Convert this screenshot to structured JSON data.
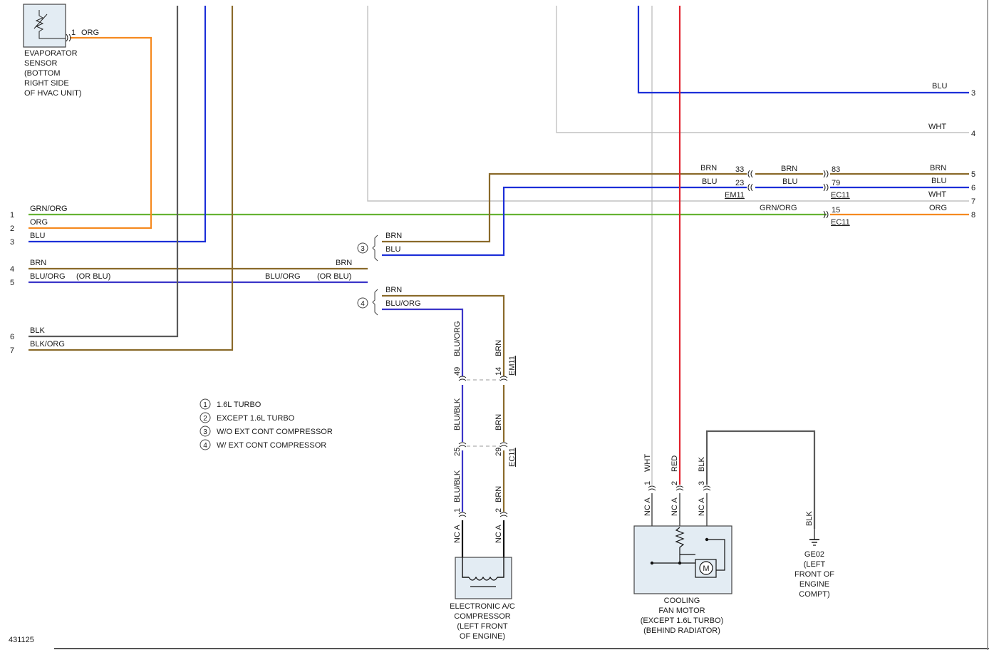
{
  "colors": {
    "brn": "#8a6a2a",
    "blu": "#1c2fd8",
    "blu_org": "#3b35c8",
    "grn_org": "#66b233",
    "org": "#f58a20",
    "red": "#e1202b",
    "blk": "#555555",
    "gray": "#bdbdbd",
    "component_fill": "#e3ecf3"
  },
  "left_pins": [
    {
      "num": "1",
      "color": "GRN/ORG"
    },
    {
      "num": "2",
      "color": "ORG"
    },
    {
      "num": "3",
      "color": "BLU"
    },
    {
      "num": "4",
      "color": "BRN"
    },
    {
      "num": "5",
      "color": "BLU/ORG",
      "alt": "(OR BLU)"
    },
    {
      "num": "6",
      "color": "BLK"
    },
    {
      "num": "7",
      "color": "BLK/ORG"
    }
  ],
  "mid_labels": {
    "brn_4": "BRN",
    "bluorg_5": "BLU/ORG",
    "bluorg_5_alt": "(OR BLU)"
  },
  "right_pins": [
    {
      "num": "3",
      "color": "BLU"
    },
    {
      "num": "4",
      "color": "WHT"
    },
    {
      "num": "5",
      "color": "BRN"
    },
    {
      "num": "6",
      "color": "BLU"
    },
    {
      "num": "7",
      "color": "WHT"
    },
    {
      "num": "8",
      "color": "ORG"
    }
  ],
  "evaporator_sensor": {
    "pin": "1",
    "color": "ORG",
    "label": [
      "EVAPORATOR",
      "SENSOR",
      "(BOTTOM",
      "RIGHT SIDE",
      "OF HVAC UNIT)"
    ]
  },
  "inline_connectors": {
    "em11_brn_pin": "33",
    "em11_blu_pin": "23",
    "em11": "EM11",
    "ec11_brn_pin": "83",
    "ec11_blu_pin": "79",
    "ec11": "EC11",
    "ec11_org_pin": "15",
    "ec11_b": "EC11",
    "brn_left": "BRN",
    "blu_left": "BLU",
    "brn_mid": "BRN",
    "blu_mid": "BLU",
    "grn_org": "GRN/ORG"
  },
  "variants": {
    "v3": {
      "num": "3",
      "wire1": "BRN",
      "wire2": "BLU"
    },
    "v4": {
      "num": "4",
      "wire1": "BRN",
      "wire2": "BLU/ORG"
    }
  },
  "compressor_wires": {
    "left_top": "BLU/ORG",
    "left_pin1": "49",
    "right_top": "BRN",
    "right_pin1": "14",
    "conn1": "EM11",
    "left_mid": "BLU/BLK",
    "right_mid": "BRN",
    "left_pin2": "25",
    "right_pin2": "29",
    "conn2": "EC11",
    "left_bot": "BLU/BLK",
    "right_bot": "BRN",
    "left_pin3": "1",
    "right_pin3": "2",
    "nca": "NC A"
  },
  "compressor_label": [
    "ELECTRONIC A/C",
    "COMPRESSOR",
    "(LEFT FRONT",
    "OF ENGINE)"
  ],
  "fan_motor": {
    "wires": [
      {
        "pin": "1",
        "color": "WHT"
      },
      {
        "pin": "2",
        "color": "RED"
      },
      {
        "pin": "3",
        "color": "BLK"
      }
    ],
    "nca": "NC A",
    "motor_symbol": "M",
    "label": [
      "COOLING",
      "FAN MOTOR",
      "(EXCEPT 1.6L TURBO)",
      "(BEHIND RADIATOR)"
    ]
  },
  "ground": {
    "wire": "BLK",
    "label": [
      "GE02",
      "(LEFT",
      "FRONT OF",
      "ENGINE",
      "COMPT)"
    ]
  },
  "legend": [
    {
      "num": "1",
      "text": "1.6L TURBO"
    },
    {
      "num": "2",
      "text": "EXCEPT 1.6L TURBO"
    },
    {
      "num": "3",
      "text": "W/O EXT CONT COMPRESSOR"
    },
    {
      "num": "4",
      "text": "W/ EXT CONT COMPRESSOR"
    }
  ],
  "diagram_id": "431125"
}
